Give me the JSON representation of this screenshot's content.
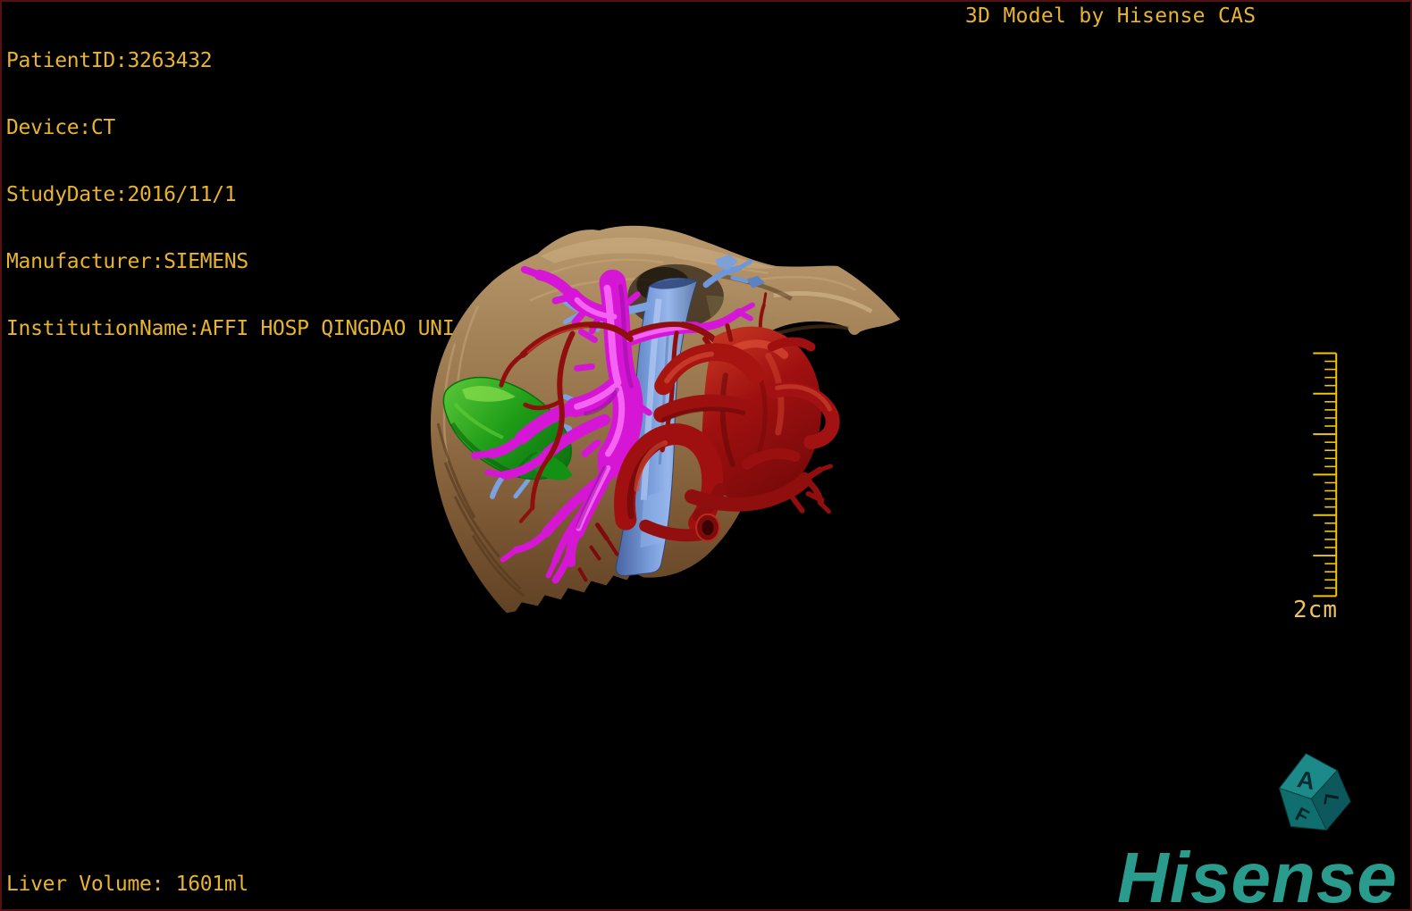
{
  "overlay": {
    "patient_info": {
      "patient_id": "PatientID:3263432",
      "device": "Device:CT",
      "study_date": "StudyDate:2016/11/1",
      "manufacturer": "Manufacturer:SIEMENS",
      "institution": "InstitutionName:AFFI HOSP QINGDAO UNI"
    },
    "watermark_title": "3D Model by Hisense CAS",
    "liver_volume": "Liver Volume: 1601ml",
    "scale_label": "2cm"
  },
  "branding": {
    "logo_text": "Hisense"
  },
  "orientation_cube": {
    "face_top": "A",
    "face_right": "L",
    "face_bottom": "F"
  },
  "ruler": {
    "major_divisions": 6,
    "minor_per_major": 5
  },
  "colors": {
    "background": "#000000",
    "frame_border": "#541111",
    "overlay_text": "#e8b42e",
    "ruler": "#f3c508",
    "scale_label": "#edc35a",
    "brand_teal": "#2a9c8e",
    "liver_tan": "#8a6842",
    "gallbladder_green": "#22a81a",
    "hepatic_vein_blue": "#6f96d6",
    "portal_vein_magenta": "#d517d5",
    "artery_red": "#a11212"
  },
  "model": {
    "structures": [
      {
        "name": "liver",
        "color": "#8a6842"
      },
      {
        "name": "hepatic-vein-ivc",
        "color": "#6f96d6"
      },
      {
        "name": "portal-vein",
        "color": "#d517d5"
      },
      {
        "name": "hepatic-artery",
        "color": "#a11212"
      },
      {
        "name": "gallbladder",
        "color": "#22a81a"
      }
    ]
  }
}
